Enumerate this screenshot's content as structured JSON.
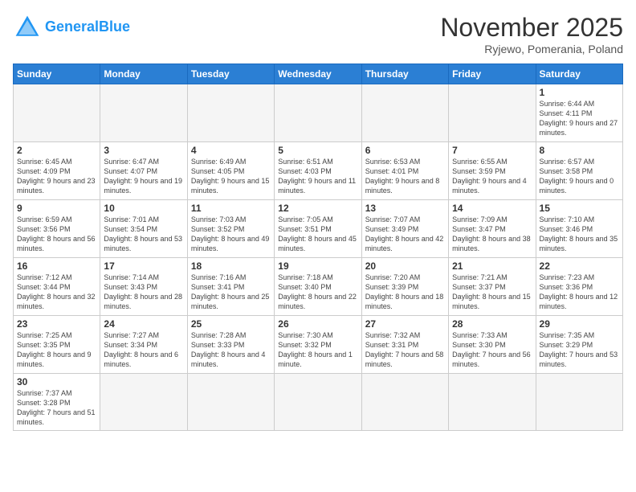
{
  "header": {
    "logo_general": "General",
    "logo_blue": "Blue",
    "month_title": "November 2025",
    "location": "Ryjewo, Pomerania, Poland"
  },
  "days_of_week": [
    "Sunday",
    "Monday",
    "Tuesday",
    "Wednesday",
    "Thursday",
    "Friday",
    "Saturday"
  ],
  "weeks": [
    [
      {
        "day": "",
        "info": ""
      },
      {
        "day": "",
        "info": ""
      },
      {
        "day": "",
        "info": ""
      },
      {
        "day": "",
        "info": ""
      },
      {
        "day": "",
        "info": ""
      },
      {
        "day": "",
        "info": ""
      },
      {
        "day": "1",
        "info": "Sunrise: 6:44 AM\nSunset: 4:11 PM\nDaylight: 9 hours\nand 27 minutes."
      }
    ],
    [
      {
        "day": "2",
        "info": "Sunrise: 6:45 AM\nSunset: 4:09 PM\nDaylight: 9 hours\nand 23 minutes."
      },
      {
        "day": "3",
        "info": "Sunrise: 6:47 AM\nSunset: 4:07 PM\nDaylight: 9 hours\nand 19 minutes."
      },
      {
        "day": "4",
        "info": "Sunrise: 6:49 AM\nSunset: 4:05 PM\nDaylight: 9 hours\nand 15 minutes."
      },
      {
        "day": "5",
        "info": "Sunrise: 6:51 AM\nSunset: 4:03 PM\nDaylight: 9 hours\nand 11 minutes."
      },
      {
        "day": "6",
        "info": "Sunrise: 6:53 AM\nSunset: 4:01 PM\nDaylight: 9 hours\nand 8 minutes."
      },
      {
        "day": "7",
        "info": "Sunrise: 6:55 AM\nSunset: 3:59 PM\nDaylight: 9 hours\nand 4 minutes."
      },
      {
        "day": "8",
        "info": "Sunrise: 6:57 AM\nSunset: 3:58 PM\nDaylight: 9 hours\nand 0 minutes."
      }
    ],
    [
      {
        "day": "9",
        "info": "Sunrise: 6:59 AM\nSunset: 3:56 PM\nDaylight: 8 hours\nand 56 minutes."
      },
      {
        "day": "10",
        "info": "Sunrise: 7:01 AM\nSunset: 3:54 PM\nDaylight: 8 hours\nand 53 minutes."
      },
      {
        "day": "11",
        "info": "Sunrise: 7:03 AM\nSunset: 3:52 PM\nDaylight: 8 hours\nand 49 minutes."
      },
      {
        "day": "12",
        "info": "Sunrise: 7:05 AM\nSunset: 3:51 PM\nDaylight: 8 hours\nand 45 minutes."
      },
      {
        "day": "13",
        "info": "Sunrise: 7:07 AM\nSunset: 3:49 PM\nDaylight: 8 hours\nand 42 minutes."
      },
      {
        "day": "14",
        "info": "Sunrise: 7:09 AM\nSunset: 3:47 PM\nDaylight: 8 hours\nand 38 minutes."
      },
      {
        "day": "15",
        "info": "Sunrise: 7:10 AM\nSunset: 3:46 PM\nDaylight: 8 hours\nand 35 minutes."
      }
    ],
    [
      {
        "day": "16",
        "info": "Sunrise: 7:12 AM\nSunset: 3:44 PM\nDaylight: 8 hours\nand 32 minutes."
      },
      {
        "day": "17",
        "info": "Sunrise: 7:14 AM\nSunset: 3:43 PM\nDaylight: 8 hours\nand 28 minutes."
      },
      {
        "day": "18",
        "info": "Sunrise: 7:16 AM\nSunset: 3:41 PM\nDaylight: 8 hours\nand 25 minutes."
      },
      {
        "day": "19",
        "info": "Sunrise: 7:18 AM\nSunset: 3:40 PM\nDaylight: 8 hours\nand 22 minutes."
      },
      {
        "day": "20",
        "info": "Sunrise: 7:20 AM\nSunset: 3:39 PM\nDaylight: 8 hours\nand 18 minutes."
      },
      {
        "day": "21",
        "info": "Sunrise: 7:21 AM\nSunset: 3:37 PM\nDaylight: 8 hours\nand 15 minutes."
      },
      {
        "day": "22",
        "info": "Sunrise: 7:23 AM\nSunset: 3:36 PM\nDaylight: 8 hours\nand 12 minutes."
      }
    ],
    [
      {
        "day": "23",
        "info": "Sunrise: 7:25 AM\nSunset: 3:35 PM\nDaylight: 8 hours\nand 9 minutes."
      },
      {
        "day": "24",
        "info": "Sunrise: 7:27 AM\nSunset: 3:34 PM\nDaylight: 8 hours\nand 6 minutes."
      },
      {
        "day": "25",
        "info": "Sunrise: 7:28 AM\nSunset: 3:33 PM\nDaylight: 8 hours\nand 4 minutes."
      },
      {
        "day": "26",
        "info": "Sunrise: 7:30 AM\nSunset: 3:32 PM\nDaylight: 8 hours\nand 1 minute."
      },
      {
        "day": "27",
        "info": "Sunrise: 7:32 AM\nSunset: 3:31 PM\nDaylight: 7 hours\nand 58 minutes."
      },
      {
        "day": "28",
        "info": "Sunrise: 7:33 AM\nSunset: 3:30 PM\nDaylight: 7 hours\nand 56 minutes."
      },
      {
        "day": "29",
        "info": "Sunrise: 7:35 AM\nSunset: 3:29 PM\nDaylight: 7 hours\nand 53 minutes."
      }
    ],
    [
      {
        "day": "30",
        "info": "Sunrise: 7:37 AM\nSunset: 3:28 PM\nDaylight: 7 hours\nand 51 minutes."
      },
      {
        "day": "",
        "info": ""
      },
      {
        "day": "",
        "info": ""
      },
      {
        "day": "",
        "info": ""
      },
      {
        "day": "",
        "info": ""
      },
      {
        "day": "",
        "info": ""
      },
      {
        "day": "",
        "info": ""
      }
    ]
  ]
}
